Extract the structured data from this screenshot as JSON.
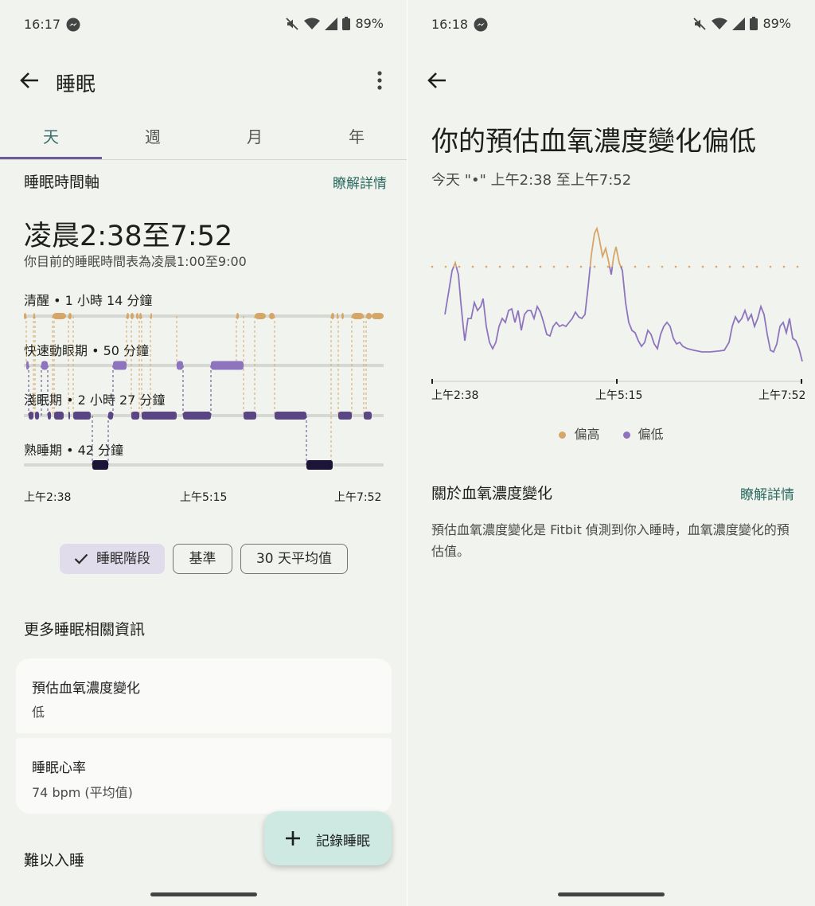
{
  "left": {
    "status": {
      "time": "16:17",
      "battery": "89%"
    },
    "header": {
      "title": "睡眠"
    },
    "tabs": [
      {
        "label": "天"
      },
      {
        "label": "週"
      },
      {
        "label": "月"
      },
      {
        "label": "年"
      }
    ],
    "timeline": {
      "heading": "睡眠時間軸",
      "link": "瞭解詳情",
      "range": "凌晨2:38至7:52",
      "schedule": "你目前的睡眠時間表為凌晨1:00至9:00"
    },
    "hypnogram": {
      "stages": [
        {
          "label": "清醒 • 1 小時 14 分鐘",
          "color": "#d5a667"
        },
        {
          "label": "快速動眼期 • 50 分鐘",
          "color": "#8e74be"
        },
        {
          "label": "淺眠期 • 2 小時 27 分鐘",
          "color": "#5a4585"
        },
        {
          "label": "熟睡期 • 42 分鐘",
          "color": "#1d1538"
        }
      ],
      "ticks": [
        "上午2:38",
        "上午5:15",
        "上午7:52"
      ]
    },
    "chips": {
      "stages": "睡眠階段",
      "baseline": "基準",
      "avg30": "30 天平均值"
    },
    "more": {
      "heading": "更多睡眠相關資訊"
    },
    "cards": {
      "spo2": {
        "title": "預估血氧濃度變化",
        "value": "低"
      },
      "heart": {
        "title": "睡眠心率",
        "value": "74 bpm (平均值)"
      }
    },
    "trouble": {
      "heading": "難以入睡"
    },
    "fab": {
      "label": "記錄睡眠"
    }
  },
  "right": {
    "status": {
      "time": "16:18",
      "battery": "89%"
    },
    "title": "你的預估血氧濃度變化偏低",
    "subtitle": "今天 \"•\" 上午2:38 至上午7:52",
    "chart": {
      "ticks": [
        "上午2:38",
        "上午5:15",
        "上午7:52"
      ],
      "legend": {
        "high": "偏高",
        "low": "偏低"
      },
      "colors": {
        "high": "#d5a667",
        "low": "#8e74be"
      }
    },
    "about": {
      "heading": "關於血氧濃度變化",
      "link": "瞭解詳情",
      "description": "預估血氧濃度變化是 Fitbit 偵測到你入睡時，血氧濃度變化的預估值。"
    }
  }
}
